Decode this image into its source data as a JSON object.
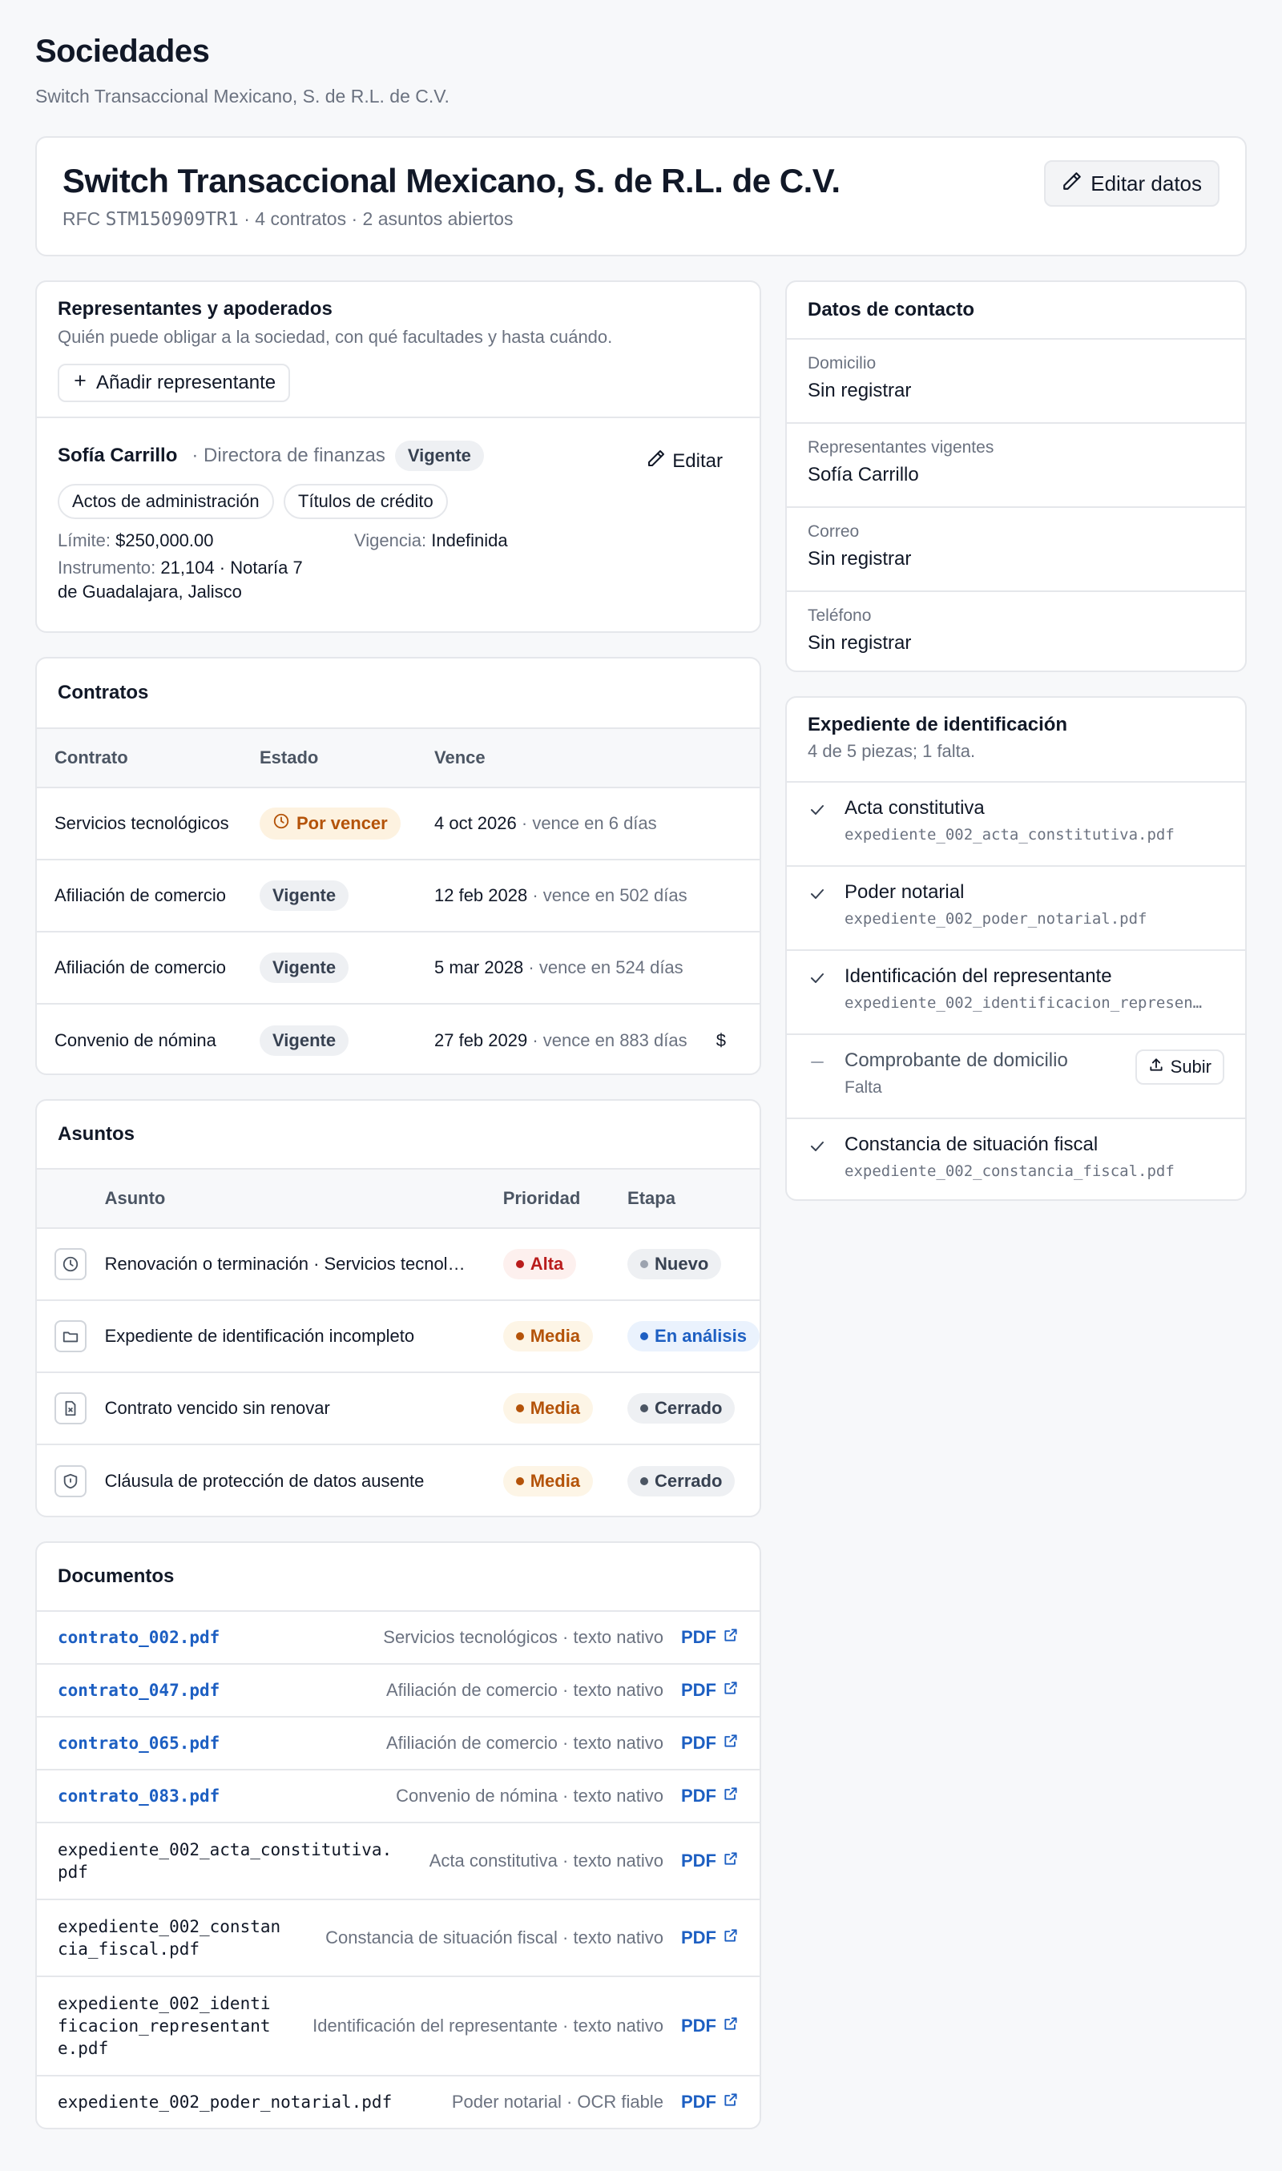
{
  "header": {
    "title": "Sociedades",
    "subtitle": "Switch Transaccional Mexicano, S. de R.L. de C.V."
  },
  "entity": {
    "name": "Switch Transaccional Mexicano, S. de R.L. de C.V.",
    "rfc_label": "RFC",
    "rfc": "STM150909TR1",
    "meta": "· 4 contratos · 2 asuntos abiertos",
    "edit_label": "Editar datos"
  },
  "representatives": {
    "title": "Representantes y apoderados",
    "description": "Quién puede obligar a la sociedad, con qué facultades y hasta cuándo.",
    "add_label": "Añadir representante",
    "items": [
      {
        "name": "Sofía Carrillo",
        "role": "· Directora de finanzas",
        "status": "Vigente",
        "edit_label": "Editar",
        "powers": [
          "Actos de administración",
          "Títulos de crédito"
        ],
        "limit_label": "Límite:",
        "limit": "$250,000.00",
        "validity_label": "Vigencia:",
        "validity": "Indefinida",
        "instrument_label": "Instrumento:",
        "instrument_line1": "21,104 · Notaría 7",
        "instrument_line2": "de Guadalajara, Jalisco"
      }
    ]
  },
  "contracts": {
    "title": "Contratos",
    "columns": [
      "Contrato",
      "Estado",
      "Vence"
    ],
    "rows": [
      {
        "name": "Servicios tecnológicos",
        "status": "Por vencer",
        "date": "4 oct 2026",
        "note": "· vence en 6 días",
        "extra": ""
      },
      {
        "name": "Afiliación de comercio",
        "status": "Vigente",
        "date": "12 feb 2028",
        "note": "· vence en 502 días",
        "extra": ""
      },
      {
        "name": "Afiliación de comercio",
        "status": "Vigente",
        "date": "5 mar 2028",
        "note": "· vence en 524 días",
        "extra": ""
      },
      {
        "name": "Convenio de nómina",
        "status": "Vigente",
        "date": "27 feb 2029",
        "note": "· vence en 883 días",
        "extra": "$"
      }
    ]
  },
  "issues": {
    "title": "Asuntos",
    "columns": [
      "Asunto",
      "Prioridad",
      "Etapa"
    ],
    "rows": [
      {
        "icon": "clock-icon",
        "title": "Renovación o terminación · Servicios tecnol…",
        "priority": "Alta",
        "stage": "Nuevo"
      },
      {
        "icon": "folder-icon",
        "title": "Expediente de identificación incompleto",
        "priority": "Media",
        "stage": "En análisis"
      },
      {
        "icon": "file-x-icon",
        "title": "Contrato vencido sin renovar",
        "priority": "Media",
        "stage": "Cerrado"
      },
      {
        "icon": "shield-icon",
        "title": "Cláusula de protección de datos ausente",
        "priority": "Media",
        "stage": "Cerrado"
      }
    ]
  },
  "documents": {
    "title": "Documentos",
    "pdf_label": "PDF",
    "rows": [
      {
        "name": "contrato_002.pdf",
        "linked": true,
        "desc": "Servicios tecnológicos · texto nativo"
      },
      {
        "name": "contrato_047.pdf",
        "linked": true,
        "desc": "Afiliación de comercio · texto nativo"
      },
      {
        "name": "contrato_065.pdf",
        "linked": true,
        "desc": "Afiliación de comercio · texto nativo"
      },
      {
        "name": "contrato_083.pdf",
        "linked": true,
        "desc": "Convenio de nómina · texto nativo"
      },
      {
        "name": "expediente_002_acta_constitutiva.\npdf",
        "linked": false,
        "desc": "Acta constitutiva · texto nativo"
      },
      {
        "name": "expediente_002_constan\ncia_fiscal.pdf",
        "linked": false,
        "desc": "Constancia de situación fiscal · texto nativo"
      },
      {
        "name": "expediente_002_identi\nficacion_representant\ne.pdf",
        "linked": false,
        "desc": "Identificación del representante · texto nativo"
      },
      {
        "name": "expediente_002_poder_notarial.pdf",
        "linked": false,
        "desc": "Poder notarial · OCR fiable"
      }
    ]
  },
  "contact": {
    "title": "Datos de contacto",
    "items": [
      {
        "label": "Domicilio",
        "value": "Sin registrar"
      },
      {
        "label": "Representantes vigentes",
        "value": "Sofía Carrillo"
      },
      {
        "label": "Correo",
        "value": "Sin registrar"
      },
      {
        "label": "Teléfono",
        "value": "Sin registrar"
      }
    ]
  },
  "identification": {
    "title": "Expediente de identificación",
    "summary": "4 de 5 piezas; 1 falta.",
    "upload_label": "Subir",
    "items": [
      {
        "title": "Acta constitutiva",
        "file": "expediente_002_acta_constitutiva.pdf",
        "present": true
      },
      {
        "title": "Poder notarial",
        "file": "expediente_002_poder_notarial.pdf",
        "present": true
      },
      {
        "title": "Identificación del representante",
        "file": "expediente_002_identificacion_represen…",
        "present": true
      },
      {
        "title": "Comprobante de domicilio",
        "file": "Falta",
        "present": false
      },
      {
        "title": "Constancia de situación fiscal",
        "file": "expediente_002_constancia_fiscal.pdf",
        "present": true
      }
    ]
  },
  "colors": {
    "accent": "#1d5fc2",
    "warning": "#b45309",
    "danger": "#b91c1c",
    "border": "#e5e7eb"
  }
}
